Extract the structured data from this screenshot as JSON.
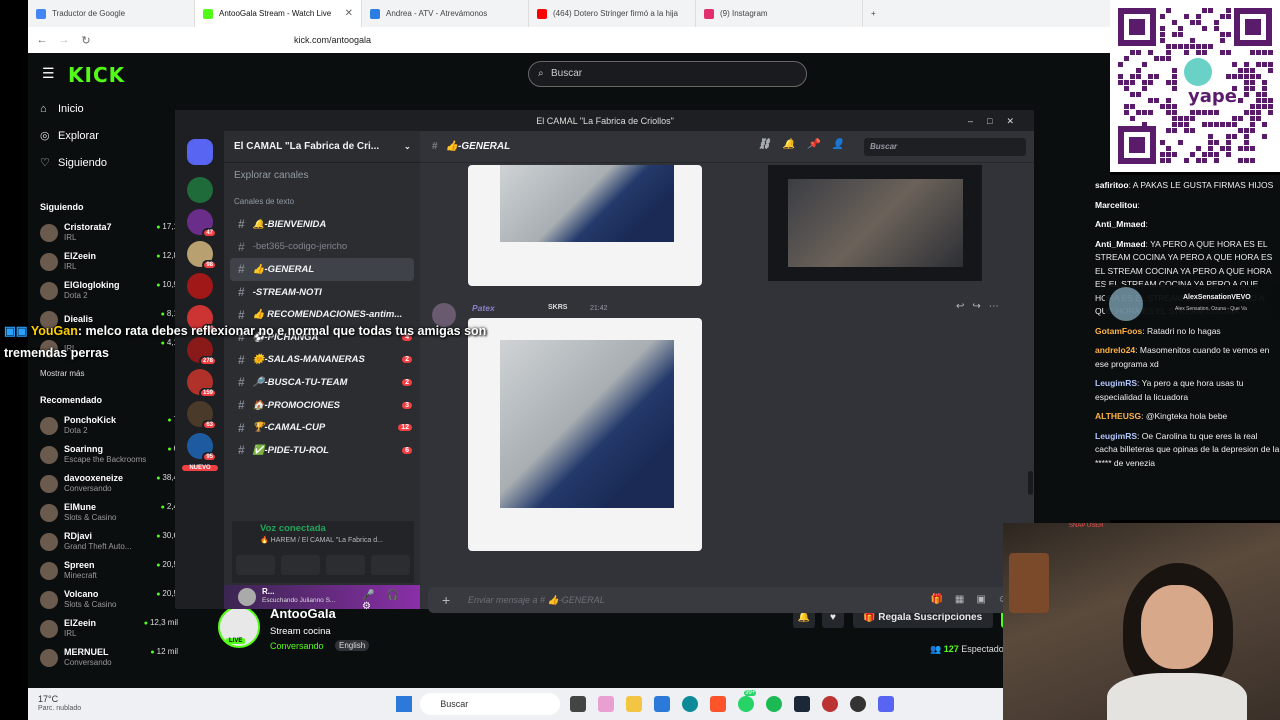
{
  "browser": {
    "tabs": [
      {
        "label": "Traductor de Google",
        "color": "#4285f4"
      },
      {
        "label": "AntooGala Stream - Watch Live",
        "color": "#53fc18"
      },
      {
        "label": "Andrea - ATV - Atrevámonos",
        "color": "#2a7de1"
      },
      {
        "label": "(464) Dotero Stringer firmó a la hija",
        "color": "#ff0000"
      },
      {
        "label": "(9) Instagram",
        "color": "#e1306c"
      }
    ],
    "url": "kick.com/antoogala"
  },
  "kick": {
    "logo": "KICK",
    "search_placeholder": "Buscar",
    "nav": [
      {
        "label": "Inicio",
        "icon": "home-icon"
      },
      {
        "label": "Explorar",
        "icon": "compass-icon"
      },
      {
        "label": "Siguiendo",
        "icon": "heart-icon"
      }
    ],
    "following_title": "Siguiendo",
    "following": [
      {
        "name": "Cristorata7",
        "game": "IRL",
        "viewers": "17,1"
      },
      {
        "name": "ElZeein",
        "game": "IRL",
        "viewers": "12,8"
      },
      {
        "name": "ElGlogloking",
        "game": "Dota 2",
        "viewers": "10,9"
      },
      {
        "name": "Diealis",
        "game": "",
        "viewers": "8,1"
      },
      {
        "name": "",
        "game": "IRL",
        "viewers": "4,1"
      }
    ],
    "show_more": "Mostrar más",
    "recommended_title": "Recomendado",
    "recommended": [
      {
        "name": "PonchoKick",
        "game": "Dota 2",
        "viewers": "7"
      },
      {
        "name": "Soarinng",
        "game": "Escape the Backrooms",
        "viewers": "6"
      },
      {
        "name": "davooxeneize",
        "game": "Conversando",
        "viewers": "38,4"
      },
      {
        "name": "ElMune",
        "game": "Slots & Casino",
        "viewers": "2,4"
      },
      {
        "name": "RDjavi",
        "game": "Grand Theft Auto...",
        "viewers": "30,6"
      },
      {
        "name": "Spreen",
        "game": "Minecraft",
        "viewers": "20,5"
      },
      {
        "name": "Volcano",
        "game": "Slots & Casino",
        "viewers": "20,5"
      },
      {
        "name": "ElZeein",
        "game": "IRL",
        "viewers": "12,3 mil"
      },
      {
        "name": "MERNUEL",
        "game": "Conversando",
        "viewers": "12 mil"
      }
    ],
    "stream": {
      "channel": "AntooGala",
      "title": "Stream cocina",
      "category": "Conversando",
      "language": "English",
      "live": "LIVE",
      "gift_button": "Regala Suscripciones",
      "viewers": "127",
      "viewers_label": "Espectadores"
    }
  },
  "overlay_chat": {
    "user": "YouGan",
    "text": ": melco rata debes reflexionar no e normal que todas tus amigas son tremendas perras"
  },
  "discord": {
    "window_title": "El CAMAL \"La Fabrica de Criollos\"",
    "guild_name": "El CAMAL \"La Fabrica de Cri...",
    "explore": "Explorar canales",
    "category": "Canales de texto",
    "new_badge": "NUEVO",
    "channels": [
      {
        "name": "🔔-BIENVENIDA",
        "unread": "",
        "muted": false
      },
      {
        "name": "-bet365-codigo-jericho",
        "unread": "",
        "muted": true
      },
      {
        "name": "👍-GENERAL",
        "unread": "",
        "muted": false,
        "selected": true
      },
      {
        "name": "-STREAM-NOTI",
        "unread": "",
        "muted": false
      },
      {
        "name": "👍 RECOMENDACIONES-antim...",
        "unread": "",
        "muted": false
      },
      {
        "name": "⚽-PICHANGA",
        "unread": "4",
        "muted": false
      },
      {
        "name": "🌞-SALAS-MANANERAS",
        "unread": "2",
        "muted": false
      },
      {
        "name": "🔎-BUSCA-TU-TEAM",
        "unread": "2",
        "muted": false
      },
      {
        "name": "🏠-PROMOCIONES",
        "unread": "3",
        "muted": false
      },
      {
        "name": "🏆-CAMAL-CUP",
        "unread": "12",
        "muted": false
      },
      {
        "name": "✅-PIDE-TU-ROL",
        "unread": "6",
        "muted": false
      }
    ],
    "server_badges": [
      "",
      "47",
      "98",
      "",
      "44",
      "278",
      "159",
      "63",
      "95"
    ],
    "voice_status": "Voz conectada",
    "voice_channel": "🔥 HAREM / El CAMAL \"La Fabrica d...",
    "user_name": "R...",
    "user_status": "Escuchando Julianno S...",
    "current_channel": "👍-GENERAL",
    "search_placeholder": "Buscar",
    "message_author": "Patex",
    "message_tag": "SKRS",
    "message_time": "21:42",
    "message_placeholder": "Enviar mensaje a # 👍-GENERAL"
  },
  "right_chat": {
    "messages": [
      {
        "user": "safiritoo",
        "color": "#ffffff",
        "text": "A PAKAS LE GUSTA FIRMAS HIJOS"
      },
      {
        "user": "Marcelitou",
        "color": "#ffffff",
        "text": ""
      },
      {
        "user": "Anti_Mmaed",
        "color": "#ffffff",
        "text": ""
      },
      {
        "user": "Anti_Mmaed",
        "color": "#ffffff",
        "text": "YA PERO A QUE HORA ES EL STREAM COCINA YA PERO A QUE HORA ES EL STREAM COCINA YA PERO A QUE HORA ES EL STREAM COCINA YA PERO A QUE HORA ES EL STREAM COCINA YA PERO A QUE HORA ES EL STREAM COCINA"
      },
      {
        "user": "GotamFoos",
        "color": "#ffb347",
        "text": "Ratadri no lo hagas"
      },
      {
        "user": "andrelo24",
        "color": "#ffb347",
        "text": "Masomenitos cuando te vemos en ese programa xd"
      },
      {
        "user": "LeugimRS",
        "color": "#b3c7ff",
        "text": "Ya pero a que hora usas tu especialidad la licuadora"
      },
      {
        "user": "ALTHEUSG",
        "color": "#ffb347",
        "text": "@Kingteka hola bebe"
      },
      {
        "user": "LeugimRS",
        "color": "#b3c7ff",
        "text": "Oe Carolina tu que eres la real cacha billeteras que opinas de la depresion de la ***** de venezia"
      }
    ],
    "popup_name": "AlexSensationVEVO",
    "popup_sub": "Alex Sensation, Ozuna - Que Va"
  },
  "qr": {
    "brand": "yape"
  },
  "webcam": {
    "sign": "SNAP USER"
  },
  "taskbar": {
    "weather_temp": "17°C",
    "weather_desc": "Parc. nublado",
    "search": "Buscar",
    "badge": "99+"
  }
}
